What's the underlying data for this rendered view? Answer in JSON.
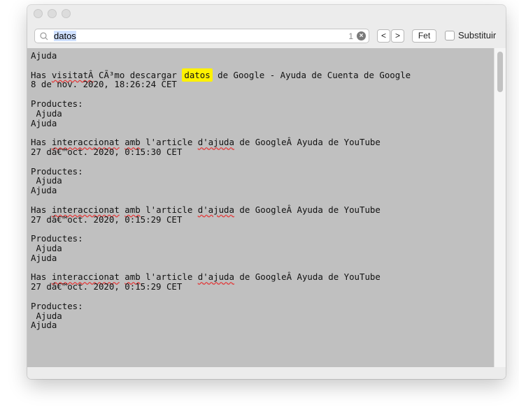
{
  "findbar": {
    "query": "datos",
    "match_count": "1",
    "clear_symbol": "×",
    "prev_label": "<",
    "next_label": ">",
    "done_label": "Fet",
    "replace_label": "Substituir",
    "replace_checked": false
  },
  "document": {
    "lines": [
      {
        "kind": "text",
        "text": "Ajuda"
      },
      {
        "kind": "blank"
      },
      {
        "kind": "match",
        "before": "Has ",
        "sq": "visitatÂ",
        "mid": " CÃ³mo descargar ",
        "found": "datos",
        "after": " de Google - Ayuda de Cuenta de Google"
      },
      {
        "kind": "text",
        "text": "8 de nov. 2020, 18:26:24 CET"
      },
      {
        "kind": "blank"
      },
      {
        "kind": "text",
        "text": "Productes:"
      },
      {
        "kind": "text",
        "text": " Ajuda"
      },
      {
        "kind": "text",
        "text": "Ajuda"
      },
      {
        "kind": "blank"
      },
      {
        "kind": "spell",
        "p1": "Has ",
        "s1": "interaccionat",
        "p2": " ",
        "s2": "amb",
        "p3": " l'article ",
        "s3": "d'ajuda",
        "p4": " de GoogleÂ Ayuda de YouTube"
      },
      {
        "kind": "text",
        "text": "27 dâ€™oct. 2020, 0:15:30 CET"
      },
      {
        "kind": "blank"
      },
      {
        "kind": "text",
        "text": "Productes:"
      },
      {
        "kind": "text",
        "text": " Ajuda"
      },
      {
        "kind": "text",
        "text": "Ajuda"
      },
      {
        "kind": "blank"
      },
      {
        "kind": "spell",
        "p1": "Has ",
        "s1": "interaccionat",
        "p2": " ",
        "s2": "amb",
        "p3": " l'article ",
        "s3": "d'ajuda",
        "p4": " de GoogleÂ Ayuda de YouTube"
      },
      {
        "kind": "text",
        "text": "27 dâ€™oct. 2020, 0:15:29 CET"
      },
      {
        "kind": "blank"
      },
      {
        "kind": "text",
        "text": "Productes:"
      },
      {
        "kind": "text",
        "text": " Ajuda"
      },
      {
        "kind": "text",
        "text": "Ajuda"
      },
      {
        "kind": "blank"
      },
      {
        "kind": "spell",
        "p1": "Has ",
        "s1": "interaccionat",
        "p2": " ",
        "s2": "amb",
        "p3": " l'article ",
        "s3": "d'ajuda",
        "p4": " de GoogleÂ Ayuda de YouTube"
      },
      {
        "kind": "text",
        "text": "27 dâ€™oct. 2020, 0:15:29 CET"
      },
      {
        "kind": "blank"
      },
      {
        "kind": "text",
        "text": "Productes:"
      },
      {
        "kind": "text",
        "text": " Ajuda"
      },
      {
        "kind": "text",
        "text": "Ajuda"
      }
    ]
  },
  "colors": {
    "content_bg": "#c0c0c0",
    "find_highlight": "#fff200",
    "spell_underline": "#e23b3b"
  }
}
